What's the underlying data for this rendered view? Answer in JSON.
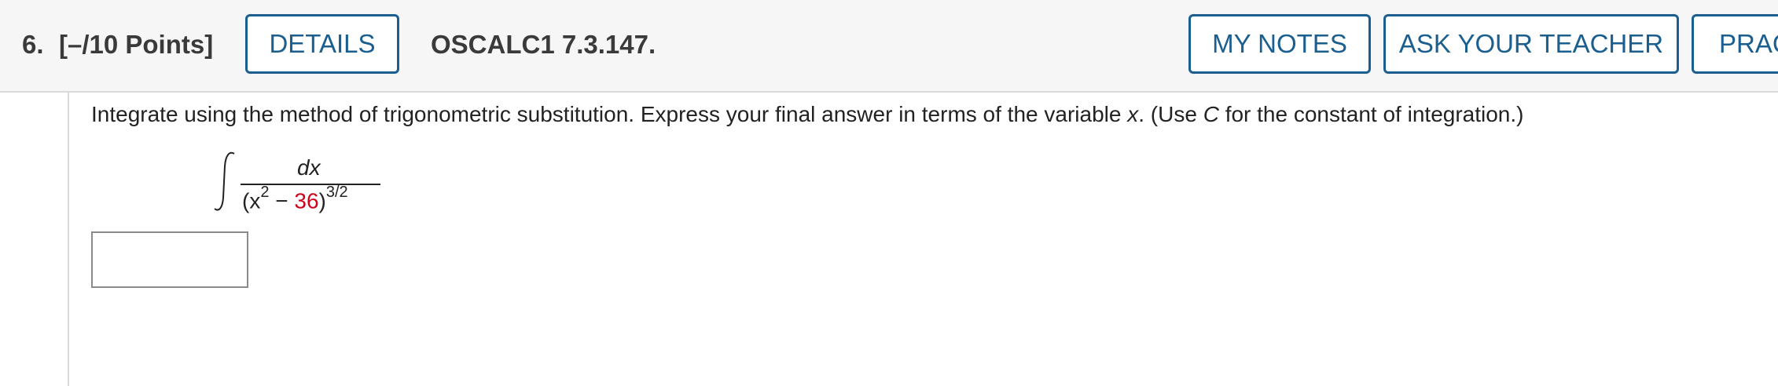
{
  "header": {
    "question_number": "6.",
    "points": "[–/10 Points]",
    "details_label": "DETAILS",
    "problem_code": "OSCALC1 7.3.147.",
    "my_notes_label": "MY NOTES",
    "ask_teacher_label": "ASK YOUR TEACHER",
    "practice_label": "PRAC"
  },
  "question": {
    "prompt_part1": "Integrate using the method of trigonometric substitution. Express your final answer in terms of the variable ",
    "prompt_var": "x",
    "prompt_part2": ". (Use ",
    "prompt_const": "C",
    "prompt_part3": " for the constant of integration.)",
    "integral": {
      "numerator": "dx",
      "denom_open": "(x",
      "denom_exp": "2",
      "denom_minus": " − ",
      "denom_constant": "36",
      "denom_close": ")",
      "outer_exp": "3/2"
    },
    "answer_value": ""
  },
  "colors": {
    "accent": "#1a5f8f",
    "highlight": "#d0021b"
  }
}
